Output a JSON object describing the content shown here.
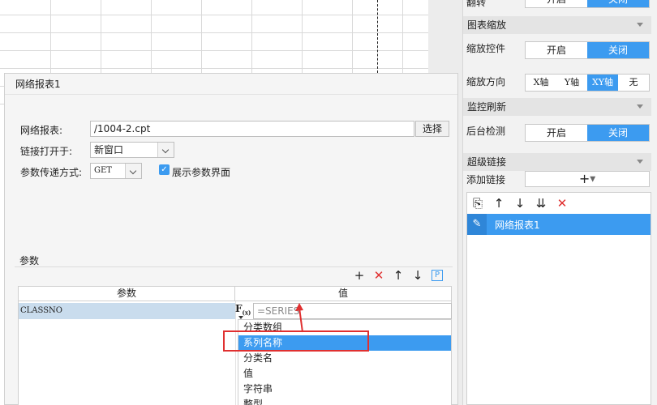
{
  "right_panel": {
    "flip_label": "翻转",
    "toggle_on": "开启",
    "toggle_off": "关闭",
    "zoom_section": "图表缩放",
    "zoom_control_label": "缩放控件",
    "zoom_direction_label": "缩放方向",
    "zoom_directions": [
      "X轴",
      "Y轴",
      "XY轴",
      "无"
    ],
    "monitor_section": "监控刷新",
    "background_check_label": "后台检测",
    "hyperlink_section": "超级链接",
    "add_link_label": "添加链接",
    "hyperlink_item": "网络报表1"
  },
  "dialog": {
    "title": "网络报表1",
    "report_label": "网络报表:",
    "report_value": "/1004-2.cpt",
    "choose_button": "选择",
    "open_in_label": "链接打开于:",
    "open_in_value": "新窗口",
    "param_method_label": "参数传递方式:",
    "param_method_value": "GET",
    "show_params_label": "展示参数界面",
    "params_section": "参数",
    "col_param": "参数",
    "col_value": "值",
    "row_param": "CLASSNO",
    "formula_value": "=SERIES",
    "dropdown_options": [
      "分类数组",
      "系列名称",
      "分类名",
      "值",
      "字符串",
      "整型"
    ],
    "selected_option": "系列名称"
  },
  "colors": {
    "accent": "#3c9bf0",
    "highlight_box": "#e03030"
  }
}
